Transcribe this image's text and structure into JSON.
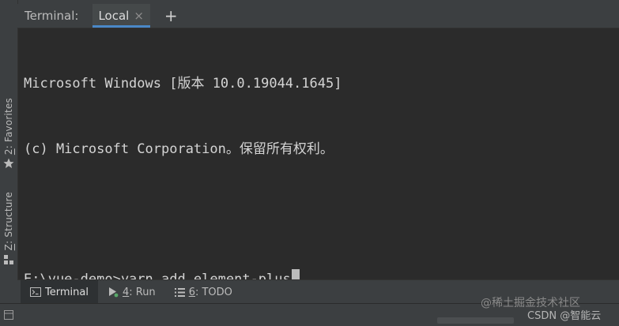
{
  "sidebar": {
    "favorites": {
      "number": "2",
      "label": ": Favorites",
      "icon": "star-icon"
    },
    "structure": {
      "number": "Z",
      "label": ": Structure",
      "icon": "structure-icon"
    }
  },
  "tabbar": {
    "title": "Terminal:",
    "active_tab": "Local",
    "close_glyph": "×",
    "add_glyph": "+"
  },
  "terminal": {
    "lines": [
      "Microsoft Windows [版本 10.0.19044.1645]",
      "(c) Microsoft Corporation。保留所有权利。",
      "",
      "E:\\vue-demo>yarn add element-plus"
    ],
    "cursor": true
  },
  "bottom_tabs": [
    {
      "label": "Terminal",
      "active": true,
      "icon": "terminal-icon"
    },
    {
      "number": "4",
      "label": ": Run",
      "active": false,
      "icon": "run-icon"
    },
    {
      "number": "6",
      "label": ": TODO",
      "active": false,
      "icon": "todo-icon"
    }
  ],
  "watermark": {
    "line1": "@稀土掘金技术社区",
    "line2": "CSDN @智能云"
  },
  "colors": {
    "accent": "#4a88c7",
    "terminal_bg": "#2b2b2b",
    "panel_bg": "#3c3f41",
    "text": "#d4d4d4"
  }
}
